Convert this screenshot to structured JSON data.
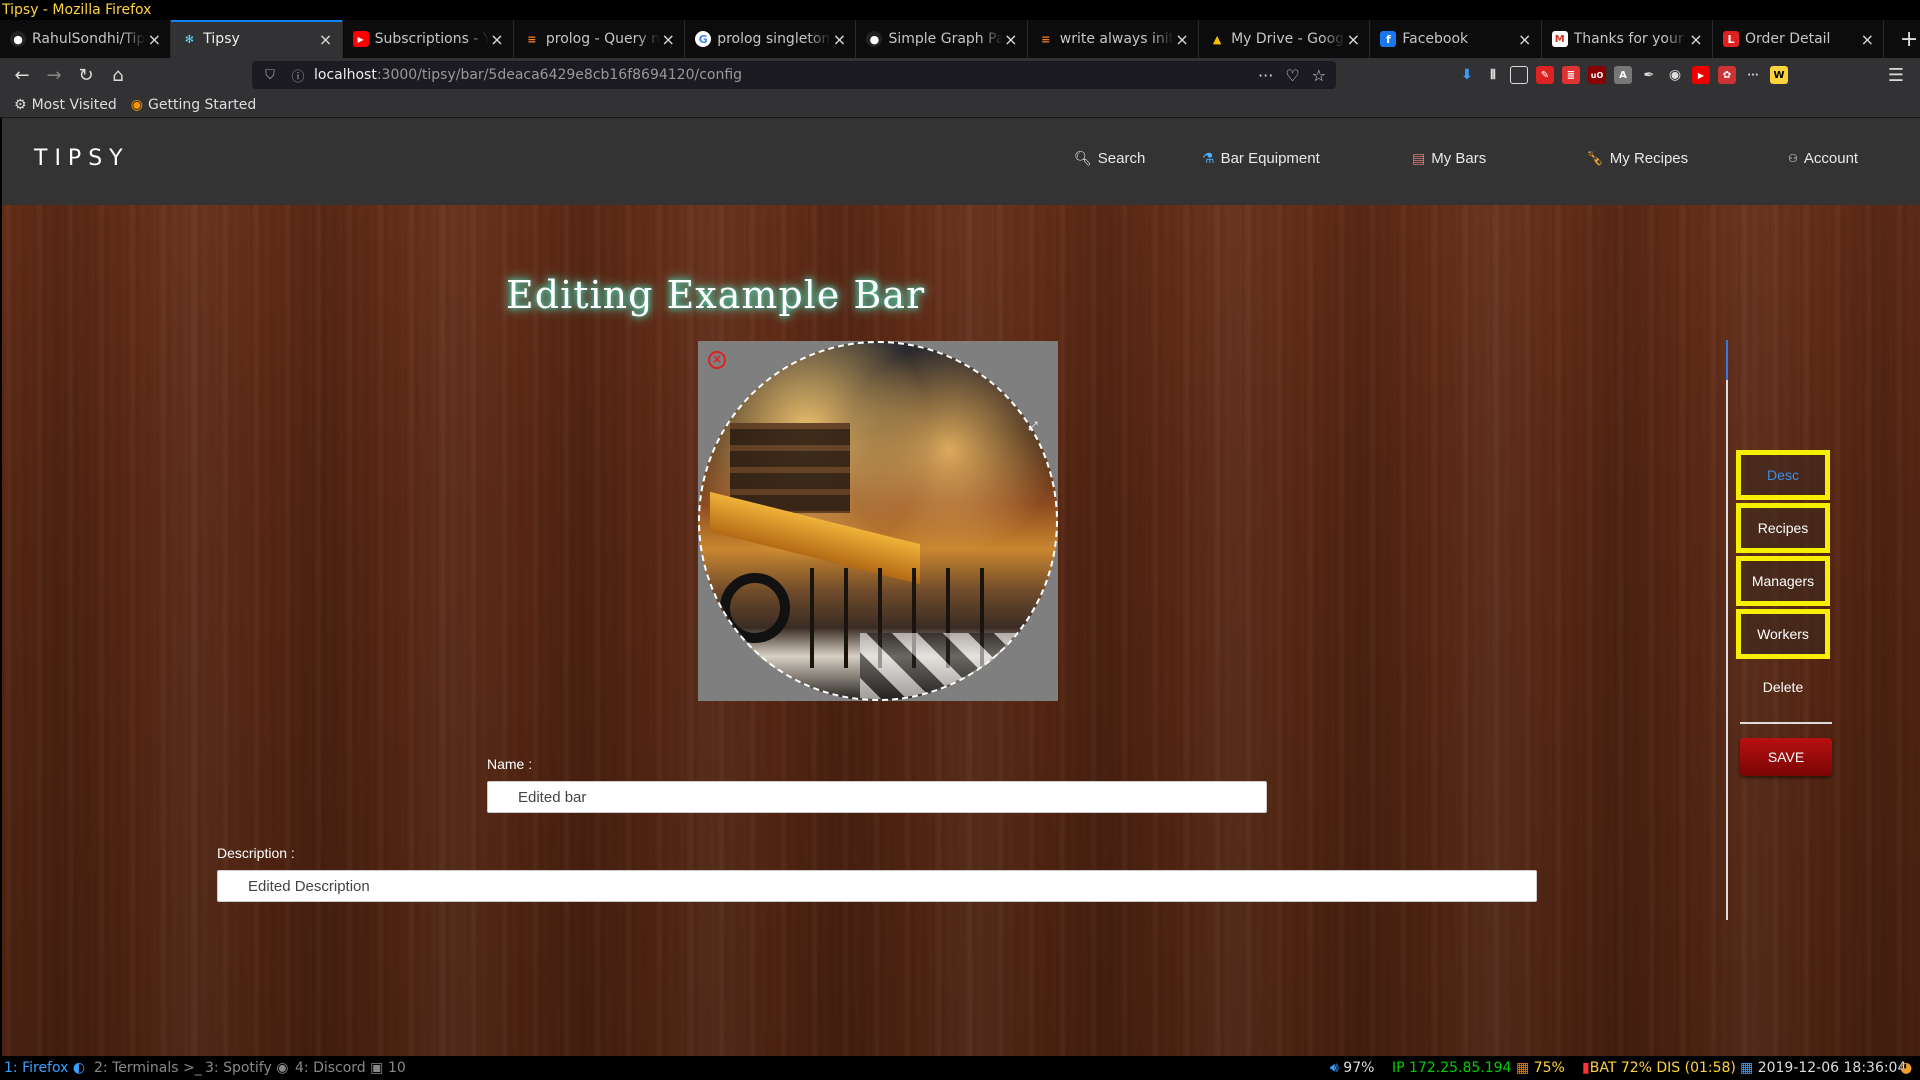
{
  "window": {
    "title": "Tipsy - Mozilla Firefox"
  },
  "tabs": [
    {
      "title": "RahulSondhi/Tipsy",
      "icon": "github-icon",
      "active": false
    },
    {
      "title": "Tipsy",
      "icon": "react-icon",
      "active": true
    },
    {
      "title": "Subscriptions - YouTube",
      "icon": "youtube-icon",
      "active": false
    },
    {
      "title": "prolog - Query not",
      "icon": "stackoverflow-icon",
      "active": false
    },
    {
      "title": "prolog singleton",
      "icon": "google-icon",
      "active": false
    },
    {
      "title": "Simple Graph Pa",
      "icon": "github-icon",
      "active": false
    },
    {
      "title": "write always init",
      "icon": "stackoverflow-icon",
      "active": false
    },
    {
      "title": "My Drive - Google",
      "icon": "drive-icon",
      "active": false
    },
    {
      "title": "Facebook",
      "icon": "facebook-icon",
      "active": false
    },
    {
      "title": "Thanks for your c",
      "icon": "gmail-icon",
      "active": false
    },
    {
      "title": "Order Detail",
      "icon": "lowes-icon",
      "active": false
    }
  ],
  "new_tab_label": "+",
  "url": {
    "host": "localhost",
    "path": ":3000/tipsy/bar/5deaca6429e8cb16f8694120/config"
  },
  "bookmarks": [
    {
      "label": "Most Visited",
      "icon": "gear-icon"
    },
    {
      "label": "Getting Started",
      "icon": "firefox-icon"
    }
  ],
  "app": {
    "brand": "TIPSY",
    "nav": {
      "search": "Search",
      "equipment": "Bar Equipment",
      "my_bars": "My Bars",
      "my_recipes": "My Recipes",
      "account": "Account"
    },
    "page_title": "Editing Example Bar",
    "form": {
      "name_label": "Name :",
      "name_value": "Edited bar",
      "description_label": "Description :",
      "description_value": "Edited Description"
    },
    "side_menu": {
      "items": [
        "Desc",
        "Recipes",
        "Managers",
        "Workers"
      ],
      "active_index": 0,
      "delete_label": "Delete",
      "save_label": "SAVE"
    }
  },
  "statusbar": {
    "workspaces": [
      {
        "label": "1: Firefox",
        "focused": true
      },
      {
        "label": "2: Terminals",
        "focused": false
      },
      {
        "label": "3: Spotify",
        "focused": false
      },
      {
        "label": "4: Discord",
        "focused": false
      },
      {
        "label": "10",
        "focused": false
      }
    ],
    "volume": "97%",
    "ip": "IP 172.25.85.194",
    "wifi": "75%",
    "battery": "BAT 72% DIS (01:58)",
    "datetime": "2019-12-06 18:36:04",
    "colors": {
      "ip": "#00d000",
      "wifi": "#ffd33a",
      "battery": "#ffd33a"
    }
  }
}
